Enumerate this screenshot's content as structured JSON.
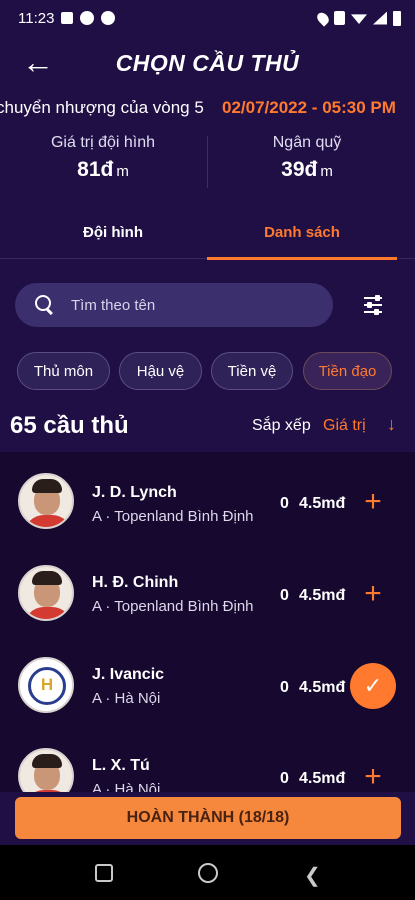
{
  "status_bar": {
    "time": "11:23"
  },
  "header": {
    "back_icon": "arrow-left-icon",
    "title": "CHỌN CẦU THỦ"
  },
  "transfer_info": {
    "deadline_label": "chuyển nhượng của vòng 5",
    "deadline_date": "02/07/2022 - 05:30 PM"
  },
  "stats": {
    "team_value_label": "Giá trị đội hình",
    "team_value": "81đ",
    "team_value_unit": "m",
    "budget_label": "Ngân quỹ",
    "budget": "39đ",
    "budget_unit": "m"
  },
  "tabs": [
    {
      "label": "Đội hình",
      "active": false
    },
    {
      "label": "Danh sách",
      "active": true
    }
  ],
  "search": {
    "placeholder": "Tìm theo tên",
    "value": ""
  },
  "position_filters": [
    {
      "label": "Thủ môn"
    },
    {
      "label": "Hậu vệ"
    },
    {
      "label": "Tiền vệ"
    },
    {
      "label": "Tiền đạo",
      "active": true
    }
  ],
  "list_header": {
    "count": "65 cầu thủ",
    "sort_label": "Sắp xếp",
    "sort_value": "Giá trị"
  },
  "players": [
    {
      "name": "J. D. Lynch",
      "club": "A · Topenland Bình Định",
      "points": "0",
      "price": "4.5mđ",
      "selected": false
    },
    {
      "name": "H. Đ. Chinh",
      "club": "A · Topenland Bình Định",
      "points": "0",
      "price": "4.5mđ",
      "selected": false
    },
    {
      "name": "J. Ivancic",
      "club": "A · Hà Nội",
      "points": "0",
      "price": "4.5mđ",
      "selected": true
    },
    {
      "name": "L. X. Tú",
      "club": "A · Hà Nội",
      "points": "0",
      "price": "4.5mđ",
      "selected": false
    }
  ],
  "footer": {
    "complete_label": "HOÀN THÀNH (18/18)"
  },
  "colors": {
    "accent": "#ff7a2e",
    "background": "#1f0f45",
    "list_background": "#16082f",
    "button": "#f5883c"
  }
}
